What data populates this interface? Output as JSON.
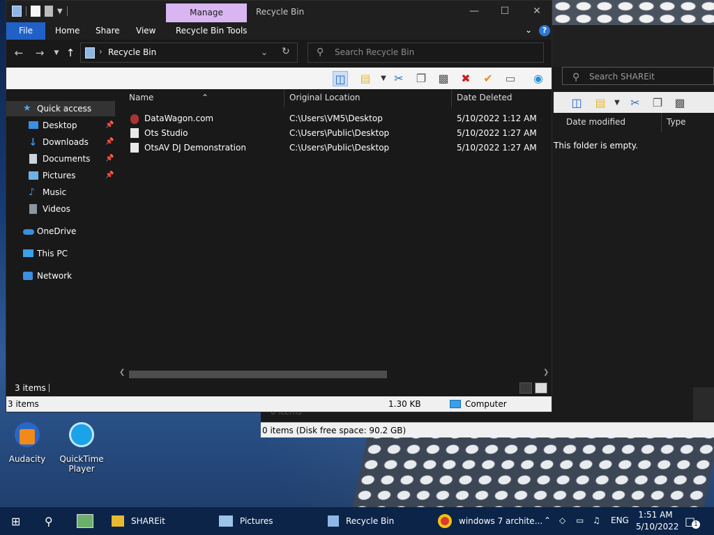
{
  "window": {
    "title": "Recycle Bin",
    "contextual_tab": "Manage",
    "controls": {
      "minimize": "—",
      "maximize": "☐",
      "close": "✕"
    }
  },
  "ribbon": {
    "tabs": [
      "File",
      "Home",
      "Share",
      "View",
      "Recycle Bin Tools"
    ],
    "help": "?"
  },
  "address": {
    "path": "Recycle Bin",
    "search_placeholder": "Search Recycle Bin"
  },
  "sidebar": {
    "items": [
      {
        "label": "Quick access",
        "icon": "star-icon",
        "pinned": false,
        "selected": true
      },
      {
        "label": "Desktop",
        "icon": "desktop-icon",
        "pinned": true
      },
      {
        "label": "Downloads",
        "icon": "download-icon",
        "pinned": true
      },
      {
        "label": "Documents",
        "icon": "documents-icon",
        "pinned": true
      },
      {
        "label": "Pictures",
        "icon": "pictures-icon",
        "pinned": true
      },
      {
        "label": "Music",
        "icon": "music-icon",
        "pinned": false
      },
      {
        "label": "Videos",
        "icon": "videos-icon",
        "pinned": false
      },
      {
        "label": "OneDrive",
        "icon": "cloud-icon",
        "pinned": false
      },
      {
        "label": "This PC",
        "icon": "pc-icon",
        "pinned": false
      },
      {
        "label": "Network",
        "icon": "network-icon",
        "pinned": false
      }
    ]
  },
  "file_list": {
    "columns": [
      "Name",
      "Original Location",
      "Date Deleted"
    ],
    "rows": [
      {
        "name": "DataWagon.com",
        "location": "C:\\Users\\VM5\\Desktop",
        "date": "5/10/2022 1:12 AM"
      },
      {
        "name": "Ots Studio",
        "location": "C:\\Users\\Public\\Desktop",
        "date": "5/10/2022 1:27 AM"
      },
      {
        "name": "OtsAV DJ Demonstration",
        "location": "C:\\Users\\Public\\Desktop",
        "date": "5/10/2022 1:27 AM"
      }
    ]
  },
  "status": {
    "items_count": "3 items",
    "bottom_count": "3 items",
    "size": "1.30 KB",
    "location": "Computer"
  },
  "back_window": {
    "search_placeholder": "Search SHAREit",
    "columns": [
      "Date modified",
      "Type"
    ],
    "empty_text": "This folder is empty.",
    "faint_status": "0 items",
    "status": "0 items (Disk free space: 90.2 GB)"
  },
  "desktop_icons": [
    {
      "label": "Audacity"
    },
    {
      "label": "QuickTime Player"
    }
  ],
  "taskbar": {
    "items": [
      {
        "label": "SHAREit"
      },
      {
        "label": "Pictures"
      },
      {
        "label": "Recycle Bin"
      },
      {
        "label": "windows 7 archite..."
      }
    ],
    "language": "ENG",
    "time": "1:51 AM",
    "date": "5/10/2022",
    "notification_count": "1"
  },
  "colors": {
    "accent": "#1f61c7",
    "manage_tab": "#d9b6f2",
    "dark_bg": "#191919",
    "taskbar": "#0b2448"
  }
}
